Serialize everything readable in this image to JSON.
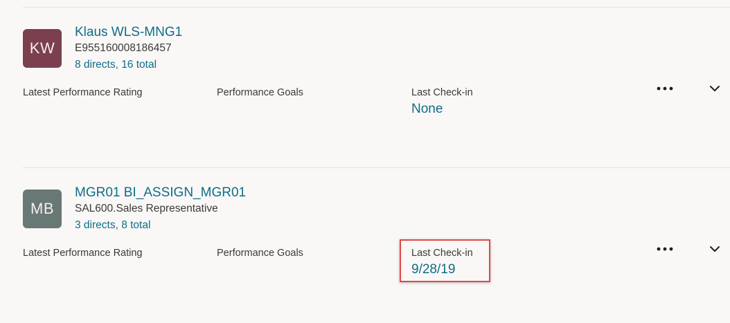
{
  "employees": [
    {
      "initials": "KW",
      "avatar_color": "#7c3f4e",
      "name": "Klaus WLS-MNG1",
      "subtitle": "E955160008186457",
      "directs": "8 directs, 16 total",
      "fields": {
        "rating_label": "Latest Performance Rating",
        "rating_value": "",
        "goals_label": "Performance Goals",
        "goals_value": "",
        "checkin_label": "Last Check-in",
        "checkin_value": "None"
      },
      "highlighted": false
    },
    {
      "initials": "MB",
      "avatar_color": "#687874",
      "name": "MGR01 BI_ASSIGN_MGR01",
      "subtitle": "SAL600.Sales Representative",
      "directs": "3 directs, 8 total",
      "fields": {
        "rating_label": "Latest Performance Rating",
        "rating_value": "",
        "goals_label": "Performance Goals",
        "goals_value": "",
        "checkin_label": "Last Check-in",
        "checkin_value": "9/28/19"
      },
      "highlighted": true
    }
  ],
  "icons": {
    "more": "more-horizontal-icon",
    "expand": "chevron-down-icon"
  },
  "colors": {
    "link": "#0e6c8b",
    "text": "#3a3937",
    "highlight_border": "#e0474b",
    "background": "#f9f8f6"
  }
}
